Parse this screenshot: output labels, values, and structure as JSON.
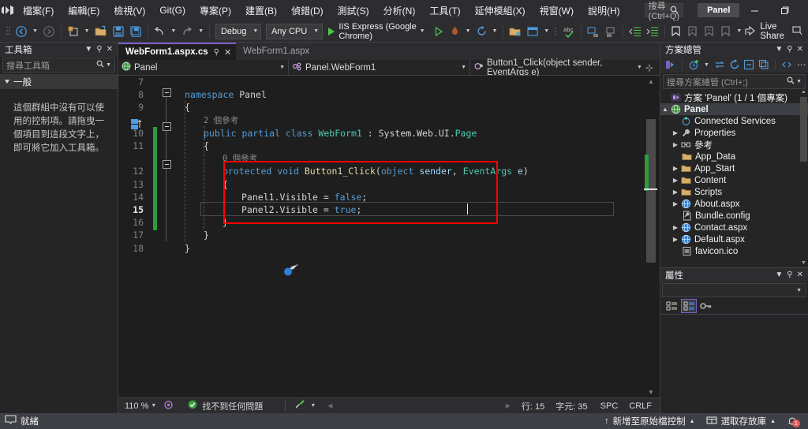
{
  "window": {
    "project_chip": "Panel",
    "minimize": "—",
    "restore": "❐",
    "close": "✕"
  },
  "menu": {
    "items": [
      {
        "label": "檔案(F)"
      },
      {
        "label": "編輯(E)"
      },
      {
        "label": "檢視(V)"
      },
      {
        "label": "Git(G)"
      },
      {
        "label": "專案(P)"
      },
      {
        "label": "建置(B)"
      },
      {
        "label": "偵錯(D)"
      },
      {
        "label": "測試(S)"
      },
      {
        "label": "分析(N)"
      },
      {
        "label": "工具(T)"
      },
      {
        "label": "延伸模組(X)"
      },
      {
        "label": "視窗(W)"
      },
      {
        "label": "說明(H)"
      }
    ],
    "search_placeholder": "搜尋 (Ctrl+Q)"
  },
  "toolbar": {
    "configuration": "Debug",
    "platform": "Any CPU",
    "run_target": "IIS Express (Google Chrome)",
    "live_share": "Live Share"
  },
  "toolbox": {
    "title": "工具箱",
    "search_placeholder": "搜尋工具箱",
    "group_label": "一般",
    "empty_message": "這個群組中沒有可以使用的控制項。請拖曳一個項目到這段文字上，即可將它加入工具箱。"
  },
  "editor": {
    "tabs": [
      {
        "label": "WebForm1.aspx.cs",
        "active": true
      },
      {
        "label": "WebForm1.aspx",
        "active": false
      }
    ],
    "nav": {
      "project": "Panel",
      "type": "Panel.WebForm1",
      "member": "Button1_Click(object sender, EventArgs e)"
    },
    "lines": [
      {
        "num": "7",
        "text": ""
      },
      {
        "num": "8",
        "text": "namespace Panel"
      },
      {
        "num": "9",
        "text": "{"
      },
      {
        "num": "10",
        "text": "    public partial class WebForm1 : System.Web.UI.Page"
      },
      {
        "num": "11",
        "text": "    {"
      },
      {
        "num": "12",
        "text": "        protected void Button1_Click(object sender, EventArgs e)"
      },
      {
        "num": "13",
        "text": "        {"
      },
      {
        "num": "14",
        "text": "            Panel1.Visible = false;"
      },
      {
        "num": "15",
        "text": "            Panel2.Visible = true;"
      },
      {
        "num": "16",
        "text": "        }"
      },
      {
        "num": "17",
        "text": "    }"
      },
      {
        "num": "18",
        "text": "}"
      }
    ],
    "codelens": [
      {
        "text": "2 個參考"
      },
      {
        "text": "0 個參考"
      }
    ],
    "status": {
      "zoom": "110 %",
      "problems": "找不到任何問題",
      "line": "行: 15",
      "column": "字元: 35",
      "spaces": "SPC",
      "eol": "CRLF"
    }
  },
  "solution_explorer": {
    "title": "方案總管",
    "search_placeholder": "搜尋方案總管 (Ctrl+;)",
    "root": "方案 'Panel' (1 / 1 個專案)",
    "nodes": [
      {
        "label": "Panel",
        "indent": 1,
        "expander": "▲",
        "icon": "web-project-icon",
        "selected": true,
        "bold": true
      },
      {
        "label": "Connected Services",
        "indent": 2,
        "expander": "",
        "icon": "connected-services-icon"
      },
      {
        "label": "Properties",
        "indent": 2,
        "expander": "▶",
        "icon": "wrench-icon"
      },
      {
        "label": "參考",
        "indent": 2,
        "expander": "▶",
        "icon": "references-icon"
      },
      {
        "label": "App_Data",
        "indent": 2,
        "expander": "",
        "icon": "folder-icon"
      },
      {
        "label": "App_Start",
        "indent": 2,
        "expander": "▶",
        "icon": "folder-icon"
      },
      {
        "label": "Content",
        "indent": 2,
        "expander": "▶",
        "icon": "folder-icon"
      },
      {
        "label": "Scripts",
        "indent": 2,
        "expander": "▶",
        "icon": "folder-icon"
      },
      {
        "label": "About.aspx",
        "indent": 2,
        "expander": "▶",
        "icon": "aspx-icon"
      },
      {
        "label": "Bundle.config",
        "indent": 2,
        "expander": "",
        "icon": "config-icon"
      },
      {
        "label": "Contact.aspx",
        "indent": 2,
        "expander": "▶",
        "icon": "aspx-icon"
      },
      {
        "label": "Default.aspx",
        "indent": 2,
        "expander": "▶",
        "icon": "aspx-icon"
      },
      {
        "label": "favicon.ico",
        "indent": 2,
        "expander": "",
        "icon": "ico-icon"
      }
    ]
  },
  "properties": {
    "title": "屬性"
  },
  "statusbar": {
    "ready": "就緒",
    "source_control": "新增至原始檔控制",
    "repo": "選取存放庫",
    "notification_count": "1"
  },
  "colors": {
    "accent": "#7e60c4",
    "annotation_red": "#ff0000",
    "changed_green": "#2e9b3c",
    "keyword_blue": "#569cd6",
    "type_teal": "#4ec9b0",
    "method_yellow": "#dcdcaa",
    "param_lightblue": "#9cdcfe",
    "statusbar_bg": "#3f3f46"
  }
}
